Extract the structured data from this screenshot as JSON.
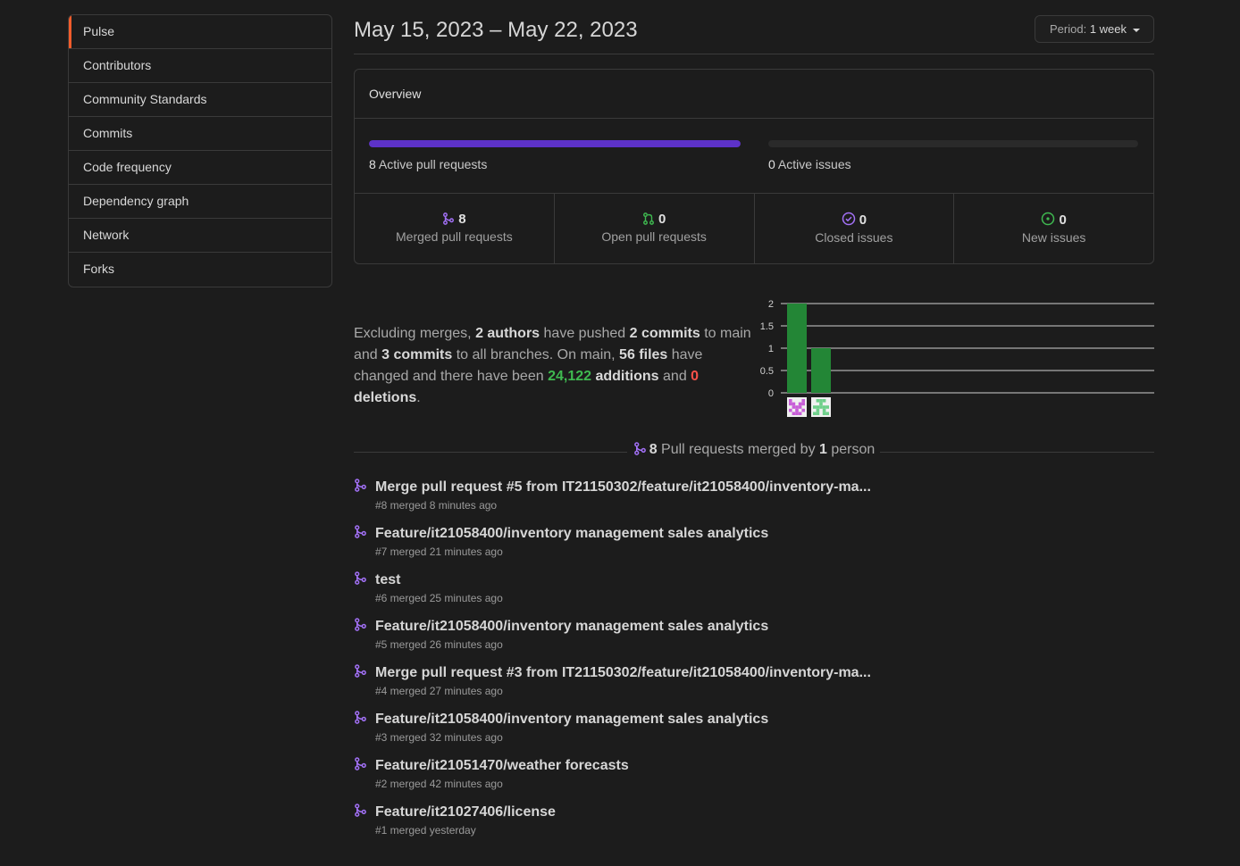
{
  "sidebar": {
    "items": [
      {
        "label": "Pulse"
      },
      {
        "label": "Contributors"
      },
      {
        "label": "Community Standards"
      },
      {
        "label": "Commits"
      },
      {
        "label": "Code frequency"
      },
      {
        "label": "Dependency graph"
      },
      {
        "label": "Network"
      },
      {
        "label": "Forks"
      }
    ]
  },
  "header": {
    "title": "May 15, 2023 – May 22, 2023",
    "period_prefix": "Period:",
    "period_value": "1 week"
  },
  "overview": {
    "heading": "Overview",
    "active_prs": {
      "count": "8",
      "label": "Active pull requests",
      "fill_percent": 100
    },
    "active_issues": {
      "count": "0",
      "label": "Active issues",
      "fill_percent": 0
    },
    "stats": [
      {
        "value": "8",
        "label": "Merged pull requests",
        "icon": "merge-icon",
        "color": "#a371f7"
      },
      {
        "value": "0",
        "label": "Open pull requests",
        "icon": "pull-request-icon",
        "color": "#3fb950"
      },
      {
        "value": "0",
        "label": "Closed issues",
        "icon": "issue-closed-icon",
        "color": "#a371f7"
      },
      {
        "value": "0",
        "label": "New issues",
        "icon": "issue-open-icon",
        "color": "#3fb950"
      }
    ]
  },
  "summary": {
    "t1": "Excluding merges, ",
    "authors": "2 authors",
    "t2": " have pushed ",
    "commits_main": "2 commits",
    "t3": " to main and ",
    "commits_all": "3 commits",
    "t4": " to all branches. On main, ",
    "files": "56 files",
    "t5": " have changed and there have been ",
    "additions_num": "24,122",
    "additions_word": " additions",
    "t6": " and ",
    "deletions_num": "0",
    "deletions_word": " deletions",
    "t7": "."
  },
  "chart_data": {
    "type": "bar",
    "categories": [
      "author-1",
      "author-2"
    ],
    "values": [
      2,
      1
    ],
    "yticks": [
      "2",
      "1.5",
      "1",
      "0.5",
      "0"
    ],
    "ylim": [
      0,
      2
    ],
    "bar_color": "#238636",
    "avatar_colors": [
      "#c85ed8",
      "#6fcf8a"
    ]
  },
  "pr_section": {
    "count": "8",
    "mid": " Pull requests merged by ",
    "people": "1",
    "tail": " person"
  },
  "pull_requests": [
    {
      "title": "Merge pull request #5 from IT21150302/feature/it21058400/inventory-ma...",
      "meta": "#8 merged 8 minutes ago"
    },
    {
      "title": "Feature/it21058400/inventory management sales analytics",
      "meta": "#7 merged 21 minutes ago"
    },
    {
      "title": "test",
      "meta": "#6 merged 25 minutes ago"
    },
    {
      "title": "Feature/it21058400/inventory management sales analytics",
      "meta": "#5 merged 26 minutes ago"
    },
    {
      "title": "Merge pull request #3 from IT21150302/feature/it21058400/inventory-ma...",
      "meta": "#4 merged 27 minutes ago"
    },
    {
      "title": "Feature/it21058400/inventory management sales analytics",
      "meta": "#3 merged 32 minutes ago"
    },
    {
      "title": "Feature/it21051470/weather forecasts",
      "meta": "#2 merged 42 minutes ago"
    },
    {
      "title": "Feature/it21027406/license",
      "meta": "#1 merged yesterday"
    }
  ]
}
